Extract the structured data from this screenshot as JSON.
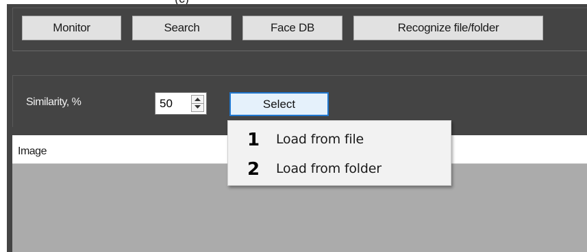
{
  "caption_fragment": "(c)",
  "toolbar": {
    "buttons": [
      {
        "label": "Monitor"
      },
      {
        "label": "Search"
      },
      {
        "label": "Face DB"
      },
      {
        "label": "Recognize file/folder"
      }
    ]
  },
  "settings": {
    "similarity_label": "Similarity, %",
    "similarity_value": "50",
    "select_button": "Select"
  },
  "dropdown": {
    "items": [
      {
        "number": "1",
        "label": "Load from file"
      },
      {
        "number": "2",
        "label": "Load from folder"
      }
    ]
  },
  "table": {
    "header": "Image"
  },
  "colors": {
    "panel_bg": "#444444",
    "button_bg": "#e1e1e1",
    "select_border": "#1f77cf",
    "select_bg": "#e5f1fb",
    "table_bg": "#ababab",
    "menu_bg": "#f2f2f2"
  },
  "icons": {
    "spin_up": "triangle-up-icon",
    "spin_down": "triangle-down-icon"
  }
}
